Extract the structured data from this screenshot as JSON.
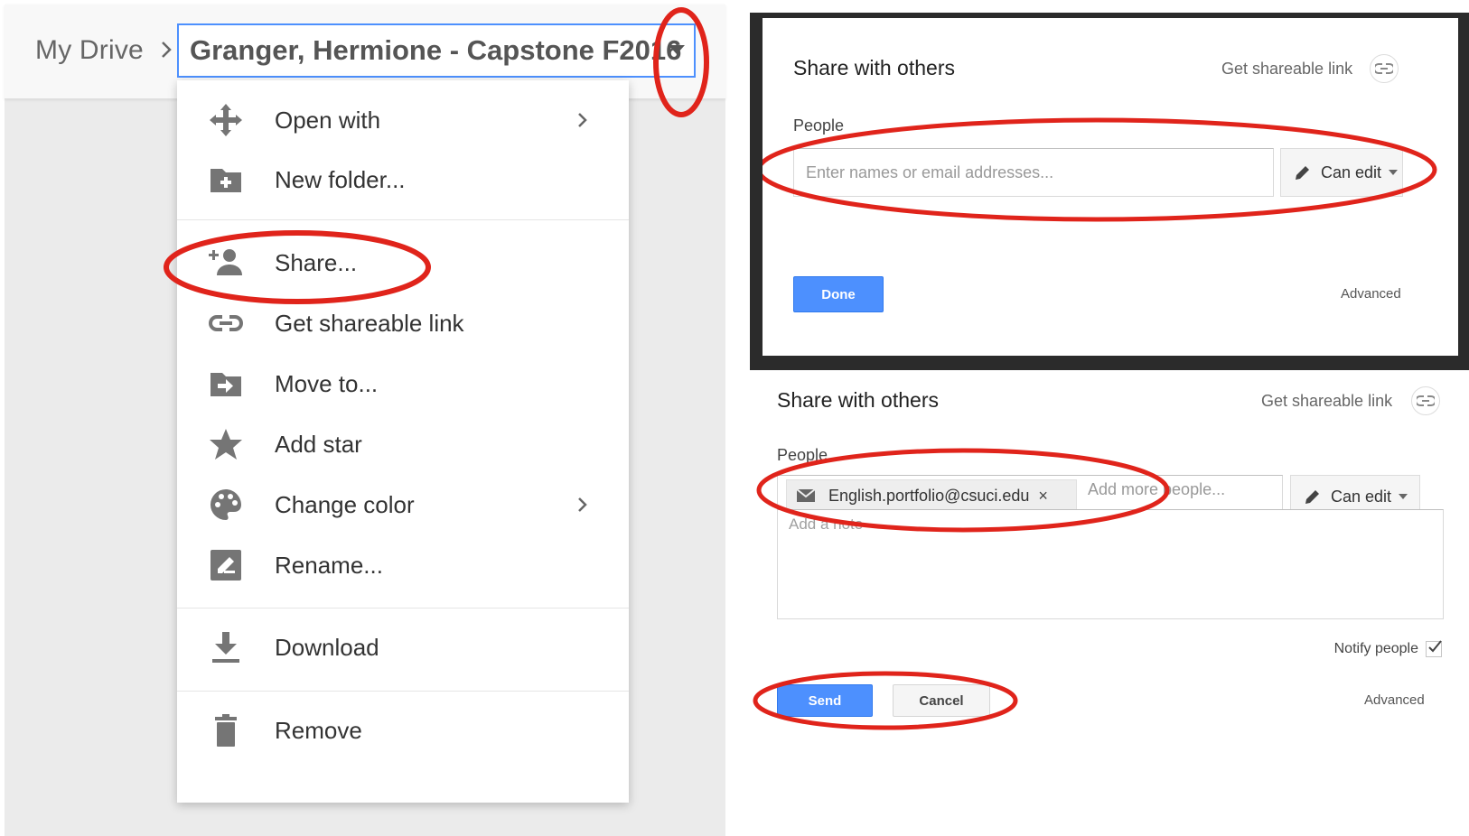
{
  "drive": {
    "breadcrumb_root": "My Drive",
    "current_folder": "Granger, Hermione - Capstone F2016",
    "menu": [
      {
        "label": "Open with",
        "icon": "open-with-icon",
        "submenu": true
      },
      {
        "label": "New folder...",
        "icon": "new-folder-icon",
        "submenu": false
      },
      {
        "label": "Share...",
        "icon": "share-person-icon",
        "submenu": false
      },
      {
        "label": "Get shareable link",
        "icon": "link-icon",
        "submenu": false
      },
      {
        "label": "Move to...",
        "icon": "move-to-folder-icon",
        "submenu": false
      },
      {
        "label": "Add star",
        "icon": "star-icon",
        "submenu": false
      },
      {
        "label": "Change color",
        "icon": "palette-icon",
        "submenu": true
      },
      {
        "label": "Rename...",
        "icon": "rename-icon",
        "submenu": false
      },
      {
        "label": "Download",
        "icon": "download-icon",
        "submenu": false
      },
      {
        "label": "Remove",
        "icon": "trash-icon",
        "submenu": false
      }
    ]
  },
  "share_dialog_empty": {
    "title": "Share with others",
    "get_link": "Get shareable link",
    "people_label": "People",
    "input_placeholder": "Enter names or email addresses...",
    "permission": "Can edit",
    "done_button": "Done",
    "advanced_link": "Advanced"
  },
  "share_dialog_filled": {
    "title": "Share with others",
    "get_link": "Get shareable link",
    "people_label": "People",
    "recipient": "English.portfolio@csuci.edu",
    "remove_symbol": "×",
    "add_more_placeholder": "Add more people...",
    "permission": "Can edit",
    "note_placeholder": "Add a note",
    "notify_label": "Notify people",
    "notify_checked": true,
    "send_button": "Send",
    "cancel_button": "Cancel",
    "advanced_link": "Advanced"
  },
  "colors": {
    "annotation_red": "#e0241b",
    "primary_blue": "#4d90fe",
    "menu_icon_grey": "#757575"
  }
}
